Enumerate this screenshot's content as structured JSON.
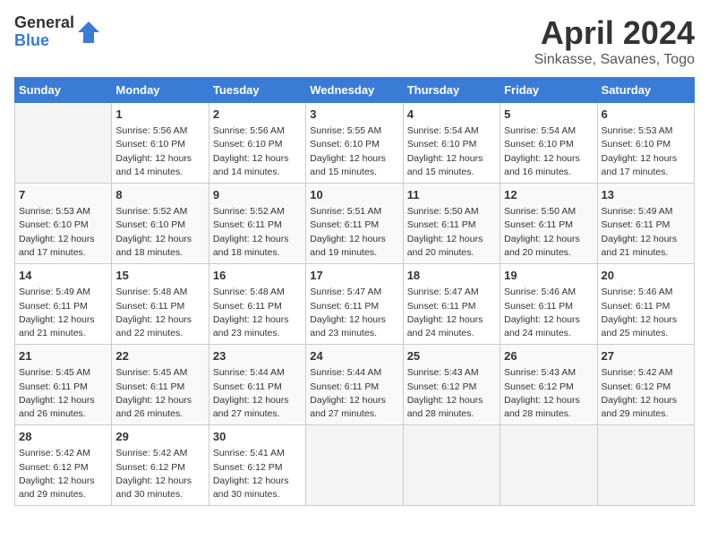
{
  "header": {
    "logo_general": "General",
    "logo_blue": "Blue",
    "title": "April 2024",
    "subtitle": "Sinkasse, Savanes, Togo"
  },
  "calendar": {
    "days_of_week": [
      "Sunday",
      "Monday",
      "Tuesday",
      "Wednesday",
      "Thursday",
      "Friday",
      "Saturday"
    ],
    "weeks": [
      [
        {
          "day": "",
          "info": ""
        },
        {
          "day": "1",
          "info": "Sunrise: 5:56 AM\nSunset: 6:10 PM\nDaylight: 12 hours\nand 14 minutes."
        },
        {
          "day": "2",
          "info": "Sunrise: 5:56 AM\nSunset: 6:10 PM\nDaylight: 12 hours\nand 14 minutes."
        },
        {
          "day": "3",
          "info": "Sunrise: 5:55 AM\nSunset: 6:10 PM\nDaylight: 12 hours\nand 15 minutes."
        },
        {
          "day": "4",
          "info": "Sunrise: 5:54 AM\nSunset: 6:10 PM\nDaylight: 12 hours\nand 15 minutes."
        },
        {
          "day": "5",
          "info": "Sunrise: 5:54 AM\nSunset: 6:10 PM\nDaylight: 12 hours\nand 16 minutes."
        },
        {
          "day": "6",
          "info": "Sunrise: 5:53 AM\nSunset: 6:10 PM\nDaylight: 12 hours\nand 17 minutes."
        }
      ],
      [
        {
          "day": "7",
          "info": "Sunrise: 5:53 AM\nSunset: 6:10 PM\nDaylight: 12 hours\nand 17 minutes."
        },
        {
          "day": "8",
          "info": "Sunrise: 5:52 AM\nSunset: 6:10 PM\nDaylight: 12 hours\nand 18 minutes."
        },
        {
          "day": "9",
          "info": "Sunrise: 5:52 AM\nSunset: 6:11 PM\nDaylight: 12 hours\nand 18 minutes."
        },
        {
          "day": "10",
          "info": "Sunrise: 5:51 AM\nSunset: 6:11 PM\nDaylight: 12 hours\nand 19 minutes."
        },
        {
          "day": "11",
          "info": "Sunrise: 5:50 AM\nSunset: 6:11 PM\nDaylight: 12 hours\nand 20 minutes."
        },
        {
          "day": "12",
          "info": "Sunrise: 5:50 AM\nSunset: 6:11 PM\nDaylight: 12 hours\nand 20 minutes."
        },
        {
          "day": "13",
          "info": "Sunrise: 5:49 AM\nSunset: 6:11 PM\nDaylight: 12 hours\nand 21 minutes."
        }
      ],
      [
        {
          "day": "14",
          "info": "Sunrise: 5:49 AM\nSunset: 6:11 PM\nDaylight: 12 hours\nand 21 minutes."
        },
        {
          "day": "15",
          "info": "Sunrise: 5:48 AM\nSunset: 6:11 PM\nDaylight: 12 hours\nand 22 minutes."
        },
        {
          "day": "16",
          "info": "Sunrise: 5:48 AM\nSunset: 6:11 PM\nDaylight: 12 hours\nand 23 minutes."
        },
        {
          "day": "17",
          "info": "Sunrise: 5:47 AM\nSunset: 6:11 PM\nDaylight: 12 hours\nand 23 minutes."
        },
        {
          "day": "18",
          "info": "Sunrise: 5:47 AM\nSunset: 6:11 PM\nDaylight: 12 hours\nand 24 minutes."
        },
        {
          "day": "19",
          "info": "Sunrise: 5:46 AM\nSunset: 6:11 PM\nDaylight: 12 hours\nand 24 minutes."
        },
        {
          "day": "20",
          "info": "Sunrise: 5:46 AM\nSunset: 6:11 PM\nDaylight: 12 hours\nand 25 minutes."
        }
      ],
      [
        {
          "day": "21",
          "info": "Sunrise: 5:45 AM\nSunset: 6:11 PM\nDaylight: 12 hours\nand 26 minutes."
        },
        {
          "day": "22",
          "info": "Sunrise: 5:45 AM\nSunset: 6:11 PM\nDaylight: 12 hours\nand 26 minutes."
        },
        {
          "day": "23",
          "info": "Sunrise: 5:44 AM\nSunset: 6:11 PM\nDaylight: 12 hours\nand 27 minutes."
        },
        {
          "day": "24",
          "info": "Sunrise: 5:44 AM\nSunset: 6:11 PM\nDaylight: 12 hours\nand 27 minutes."
        },
        {
          "day": "25",
          "info": "Sunrise: 5:43 AM\nSunset: 6:12 PM\nDaylight: 12 hours\nand 28 minutes."
        },
        {
          "day": "26",
          "info": "Sunrise: 5:43 AM\nSunset: 6:12 PM\nDaylight: 12 hours\nand 28 minutes."
        },
        {
          "day": "27",
          "info": "Sunrise: 5:42 AM\nSunset: 6:12 PM\nDaylight: 12 hours\nand 29 minutes."
        }
      ],
      [
        {
          "day": "28",
          "info": "Sunrise: 5:42 AM\nSunset: 6:12 PM\nDaylight: 12 hours\nand 29 minutes."
        },
        {
          "day": "29",
          "info": "Sunrise: 5:42 AM\nSunset: 6:12 PM\nDaylight: 12 hours\nand 30 minutes."
        },
        {
          "day": "30",
          "info": "Sunrise: 5:41 AM\nSunset: 6:12 PM\nDaylight: 12 hours\nand 30 minutes."
        },
        {
          "day": "",
          "info": ""
        },
        {
          "day": "",
          "info": ""
        },
        {
          "day": "",
          "info": ""
        },
        {
          "day": "",
          "info": ""
        }
      ]
    ]
  }
}
